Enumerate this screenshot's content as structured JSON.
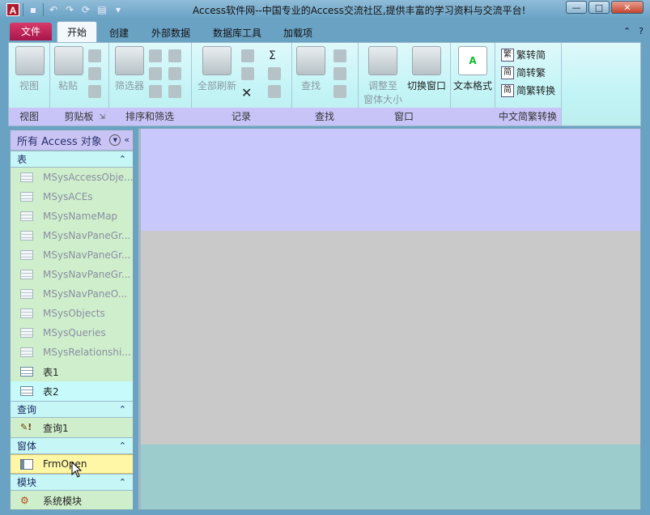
{
  "window": {
    "title": "Access软件网--中国专业的Access交流社区,提供丰富的学习资料与交流平台!",
    "app_icon_letter": "A",
    "controls": [
      "—",
      "□",
      "✕"
    ]
  },
  "tabs": {
    "file": "文件",
    "home": "开始",
    "create": "创建",
    "external": "外部数据",
    "dbtools": "数据库工具",
    "addins": "加载项"
  },
  "ribbon": {
    "view": {
      "button": "视图",
      "group": "视图"
    },
    "clipboard": {
      "button": "粘贴",
      "group": "剪贴板"
    },
    "sortfilter": {
      "button": "筛选器",
      "group": "排序和筛选"
    },
    "records": {
      "button": "全部刷新",
      "group": "记录",
      "sigma": "Σ"
    },
    "find": {
      "button": "查找",
      "group": "查找"
    },
    "window": {
      "button1_line1": "调整至",
      "button1_line2": "窗体大小",
      "button2": "切换窗口",
      "group": "窗口"
    },
    "textformat": {
      "button": "文本格式",
      "icon_letter": "A"
    },
    "chinese": {
      "item1": "繁转简",
      "item2": "简转繁",
      "item3": "简繁转换",
      "group": "中文简繁转换"
    }
  },
  "nav": {
    "header": "所有 Access 对象",
    "sections": [
      {
        "title": "表",
        "items": [
          {
            "label": "MSysAccessObje...",
            "dim": true
          },
          {
            "label": "MSysACEs",
            "dim": true
          },
          {
            "label": "MSysNameMap",
            "dim": true
          },
          {
            "label": "MSysNavPaneGr...",
            "dim": true
          },
          {
            "label": "MSysNavPaneGr...",
            "dim": true
          },
          {
            "label": "MSysNavPaneGr...",
            "dim": true
          },
          {
            "label": "MSysNavPaneO...",
            "dim": true
          },
          {
            "label": "MSysObjects",
            "dim": true
          },
          {
            "label": "MSysQueries",
            "dim": true
          },
          {
            "label": "MSysRelationshi...",
            "dim": true
          },
          {
            "label": "表1",
            "dim": false
          },
          {
            "label": "表2",
            "dim": false
          }
        ]
      },
      {
        "title": "查询",
        "items": [
          {
            "label": "查询1"
          }
        ]
      },
      {
        "title": "窗体",
        "items": [
          {
            "label": "FrmOpen"
          }
        ]
      },
      {
        "title": "模块",
        "items": [
          {
            "label": "系统模块"
          }
        ]
      }
    ]
  },
  "colors": {
    "nav_bg": "#cfeecc",
    "section_bg": "#c7f6f6",
    "selected_bg": "#fff7a6",
    "main_top": "#c9c8fc",
    "main_bottom": "#9ccccc",
    "file_tab": "#c21f57"
  }
}
